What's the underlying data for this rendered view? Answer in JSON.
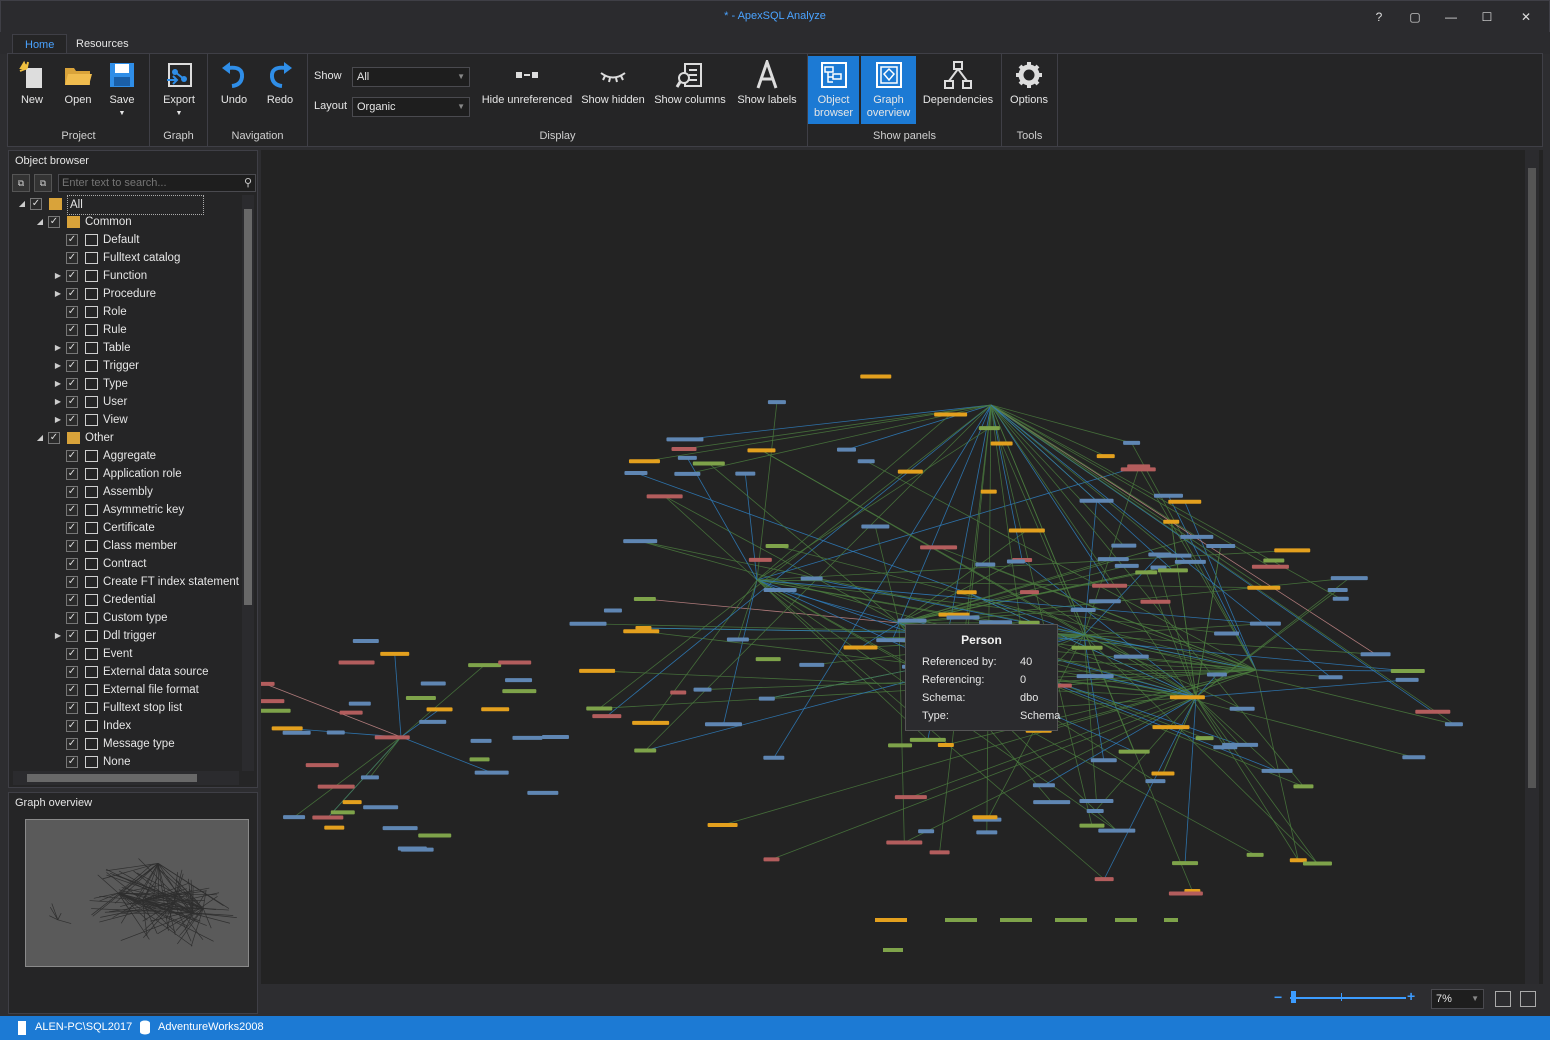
{
  "window": {
    "title": "* - ApexSQL Analyze",
    "help": "?",
    "restore": "▢",
    "minimize": "—",
    "maximize": "☐",
    "close": "✕"
  },
  "tabs": [
    {
      "label": "Home"
    },
    {
      "label": "Resources"
    }
  ],
  "ribbon": {
    "project": {
      "label": "Project",
      "new": "New",
      "open": "Open",
      "save": "Save"
    },
    "graph": {
      "label": "Graph",
      "export": "Export"
    },
    "navigation": {
      "label": "Navigation",
      "undo": "Undo",
      "redo": "Redo"
    },
    "display": {
      "label": "Display",
      "show_label": "Show",
      "show_value": "All",
      "layout_label": "Layout",
      "layout_value": "Organic",
      "hide_unreferenced": "Hide unreferenced",
      "show_hidden": "Show hidden",
      "show_columns": "Show columns",
      "show_labels": "Show labels"
    },
    "panels": {
      "label": "Show panels",
      "object_browser_1": "Object",
      "object_browser_2": "browser",
      "graph_overview_1": "Graph",
      "graph_overview_2": "overview",
      "dependencies": "Dependencies"
    },
    "tools": {
      "label": "Tools",
      "options": "Options"
    }
  },
  "object_browser": {
    "title": "Object browser",
    "search_placeholder": "Enter text to search...",
    "tree": [
      {
        "label": "All",
        "level": 0,
        "expand": "◢",
        "icon": "folder-icon"
      },
      {
        "label": "Common",
        "level": 1,
        "expand": "◢",
        "icon": "folder-icon"
      },
      {
        "label": "Default",
        "level": 2,
        "expand": "",
        "icon": "default-icon"
      },
      {
        "label": "Fulltext catalog",
        "level": 2,
        "expand": "",
        "icon": "fulltext-catalog-icon"
      },
      {
        "label": "Function",
        "level": 2,
        "expand": "▶",
        "icon": "function-icon"
      },
      {
        "label": "Procedure",
        "level": 2,
        "expand": "▶",
        "icon": "procedure-icon"
      },
      {
        "label": "Role",
        "level": 2,
        "expand": "",
        "icon": "role-icon"
      },
      {
        "label": "Rule",
        "level": 2,
        "expand": "",
        "icon": "rule-icon"
      },
      {
        "label": "Table",
        "level": 2,
        "expand": "▶",
        "icon": "table-icon"
      },
      {
        "label": "Trigger",
        "level": 2,
        "expand": "▶",
        "icon": "trigger-icon"
      },
      {
        "label": "Type",
        "level": 2,
        "expand": "▶",
        "icon": "type-icon"
      },
      {
        "label": "User",
        "level": 2,
        "expand": "▶",
        "icon": "user-icon"
      },
      {
        "label": "View",
        "level": 2,
        "expand": "▶",
        "icon": "view-icon"
      },
      {
        "label": "Other",
        "level": 1,
        "expand": "◢",
        "icon": "folder-icon"
      },
      {
        "label": "Aggregate",
        "level": 2,
        "expand": "",
        "icon": "aggregate-icon"
      },
      {
        "label": "Application role",
        "level": 2,
        "expand": "",
        "icon": "application-role-icon"
      },
      {
        "label": "Assembly",
        "level": 2,
        "expand": "",
        "icon": "assembly-icon"
      },
      {
        "label": "Asymmetric key",
        "level": 2,
        "expand": "",
        "icon": "asymmetric-key-icon"
      },
      {
        "label": "Certificate",
        "level": 2,
        "expand": "",
        "icon": "certificate-icon"
      },
      {
        "label": "Class member",
        "level": 2,
        "expand": "",
        "icon": "class-member-icon"
      },
      {
        "label": "Contract",
        "level": 2,
        "expand": "",
        "icon": "contract-icon"
      },
      {
        "label": "Create FT index statement",
        "level": 2,
        "expand": "",
        "icon": "ft-index-icon"
      },
      {
        "label": "Credential",
        "level": 2,
        "expand": "",
        "icon": "credential-icon"
      },
      {
        "label": "Custom type",
        "level": 2,
        "expand": "",
        "icon": "custom-type-icon"
      },
      {
        "label": "Ddl trigger",
        "level": 2,
        "expand": "▶",
        "icon": "ddl-trigger-icon"
      },
      {
        "label": "Event",
        "level": 2,
        "expand": "",
        "icon": "event-icon"
      },
      {
        "label": "External data source",
        "level": 2,
        "expand": "",
        "icon": "external-data-source-icon"
      },
      {
        "label": "External file format",
        "level": 2,
        "expand": "",
        "icon": "external-file-format-icon"
      },
      {
        "label": "Fulltext stop list",
        "level": 2,
        "expand": "",
        "icon": "fulltext-stop-list-icon"
      },
      {
        "label": "Index",
        "level": 2,
        "expand": "",
        "icon": "index-icon"
      },
      {
        "label": "Message type",
        "level": 2,
        "expand": "",
        "icon": "message-type-icon"
      },
      {
        "label": "None",
        "level": 2,
        "expand": "",
        "icon": "none-icon"
      }
    ]
  },
  "graph_overview": {
    "title": "Graph overview"
  },
  "tooltip": {
    "title": "Person",
    "rows": [
      {
        "key": "Referenced by:",
        "value": "40"
      },
      {
        "key": "Referencing:",
        "value": "0"
      },
      {
        "key": "Schema:",
        "value": "dbo"
      },
      {
        "key": "Type:",
        "value": "Schema"
      }
    ]
  },
  "zoom": {
    "value": "7%",
    "minus": "−",
    "plus": "+"
  },
  "status": {
    "server": "ALEN-PC\\SQL2017",
    "database": "AdventureWorks2008"
  },
  "colors": {
    "accent": "#1c7ad4",
    "node_blue": "#5f86b3",
    "node_green": "#7ea34a",
    "node_yellow": "#e3a01e",
    "node_red": "#b35d5d",
    "edge_green": "#4a7a3e",
    "edge_blue": "#2f7fc0",
    "edge_pink": "#c88a8a"
  }
}
